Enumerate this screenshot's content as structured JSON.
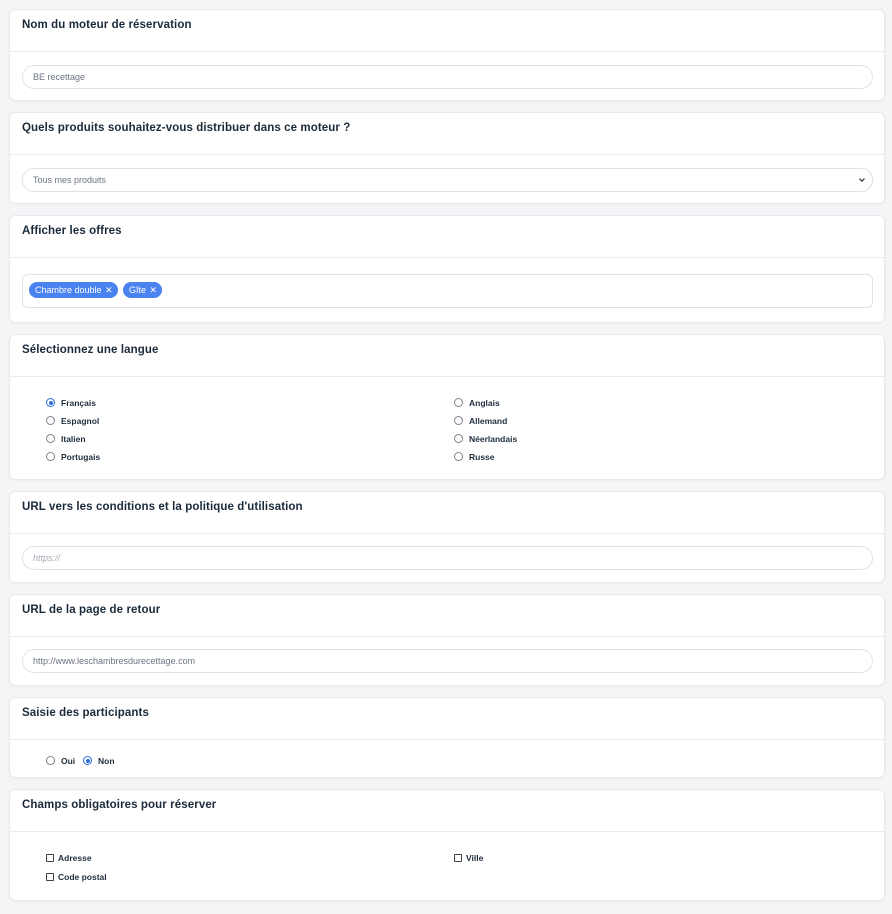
{
  "booking_engine_name": {
    "title": "Nom du moteur de réservation",
    "value": "BE recettage"
  },
  "products": {
    "title": "Quels produits souhaitez-vous distribuer dans ce moteur ?",
    "selected": "Tous mes produits",
    "icon": "chevron-down-icon"
  },
  "offers": {
    "title": "Afficher les offres",
    "tags": [
      {
        "label": "Chambre double"
      },
      {
        "label": "Gîte"
      }
    ],
    "tag_color": "#4a82f0"
  },
  "language": {
    "title": "Sélectionnez une langue",
    "selected": "Français",
    "options": [
      {
        "label": "Français",
        "checked": true
      },
      {
        "label": "Anglais",
        "checked": false
      },
      {
        "label": "Espagnol",
        "checked": false
      },
      {
        "label": "Allemand",
        "checked": false
      },
      {
        "label": "Italien",
        "checked": false
      },
      {
        "label": "Néerlandais",
        "checked": false
      },
      {
        "label": "Portugais",
        "checked": false
      },
      {
        "label": "Russe",
        "checked": false
      }
    ]
  },
  "terms_url": {
    "title": "URL vers les conditions et la politique d'utilisation",
    "placeholder": "https://",
    "value": ""
  },
  "return_url": {
    "title": "URL de la page de retour",
    "value": "http://www.leschambresdurecettage.com"
  },
  "participants": {
    "title": "Saisie des participants",
    "options": [
      {
        "label": "Oui",
        "checked": false
      },
      {
        "label": "Non",
        "checked": true
      }
    ]
  },
  "required_fields": {
    "title": "Champs obligatoires pour réserver",
    "fields": [
      {
        "label": "Adresse",
        "checked": false
      },
      {
        "label": "Ville",
        "checked": false
      },
      {
        "label": "Code postal",
        "checked": false
      }
    ]
  },
  "accent_color": "#2d6cdf"
}
